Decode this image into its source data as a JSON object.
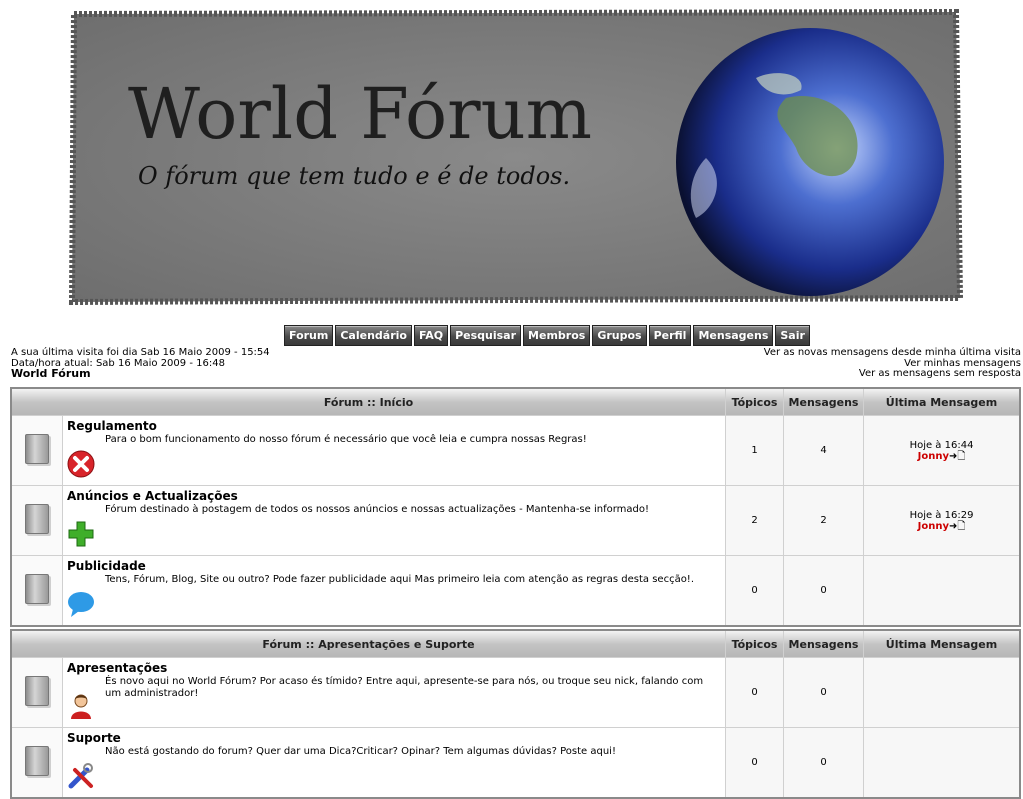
{
  "banner": {
    "title": "World Fórum",
    "subtitle": "O fórum que tem tudo e é de todos."
  },
  "nav": [
    "Forum",
    "Calendário",
    "FAQ",
    "Pesquisar",
    "Membros",
    "Grupos",
    "Perfil",
    "Mensagens",
    "Sair"
  ],
  "info": {
    "last_visit": "A sua última visita foi dia Sab 16 Maio 2009 - 15:54",
    "current_time": "Data/hora atual: Sab 16 Maio 2009 - 16:48",
    "forum_name": "World Fórum",
    "link_new": "Ver as novas mensagens desde minha última visita",
    "link_mine": "Ver minhas mensagens",
    "link_unanswered": "Ver as mensagens sem resposta"
  },
  "headers": {
    "topics": "Tópicos",
    "messages": "Mensagens",
    "last": "Última Mensagem"
  },
  "categories": [
    {
      "title": "Fórum :: Início",
      "forums": [
        {
          "name": "Regulamento",
          "desc": "Para o bom funcionamento do nosso fórum é necessário que você leia e cumpra nossas Regras!",
          "topics": "1",
          "messages": "4",
          "last_time": "Hoje à 16:44",
          "last_user": "Jonny",
          "icon": "red-x-icon"
        },
        {
          "name": "Anúncios e Actualizações",
          "desc": "Fórum destinado à postagem de todos os nossos anúncios e nossas actualizações - Mantenha-se informado!",
          "topics": "2",
          "messages": "2",
          "last_time": "Hoje à 16:29",
          "last_user": "Jonny",
          "icon": "green-plus-icon"
        },
        {
          "name": "Publicidade",
          "desc": "Tens, Fórum, Blog, Site ou outro? Pode fazer publicidade aqui Mas primeiro leia com atenção as regras desta secção!.",
          "topics": "0",
          "messages": "0",
          "icon": "speech-bubble-icon"
        }
      ]
    },
    {
      "title": "Fórum :: Apresentações e Suporte",
      "forums": [
        {
          "name": "Apresentações",
          "desc": "És novo aqui no World Fórum? Por acaso és tímido? Entre aqui, apresente-se para nós, ou troque seu nick, falando com um administrador!",
          "topics": "0",
          "messages": "0",
          "icon": "user-icon"
        },
        {
          "name": "Suporte",
          "desc": "Não está gostando do forum? Quer dar uma Dica?Criticar? Opinar? Tem algumas dúvidas? Poste aqui!",
          "topics": "0",
          "messages": "0",
          "icon": "tools-icon"
        }
      ]
    }
  ]
}
